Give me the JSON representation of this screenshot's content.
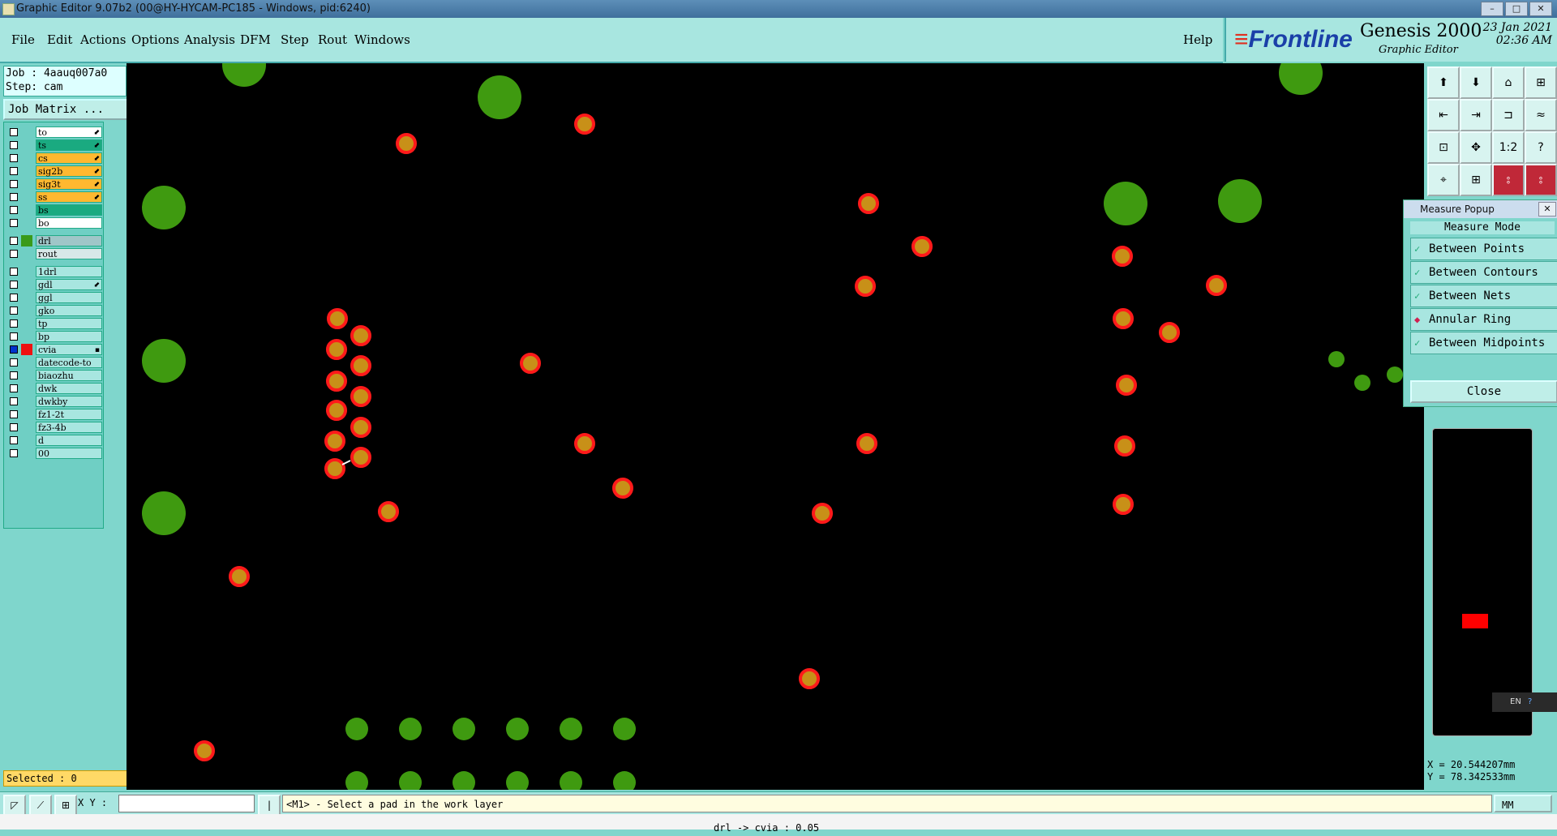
{
  "window": {
    "title": "Graphic Editor 9.07b2 (00@HY-HYCAM-PC185 - Windows, pid:6240)"
  },
  "menu": [
    {
      "label": "File",
      "name": "menu-file"
    },
    {
      "label": "Edit",
      "name": "menu-edit"
    },
    {
      "label": "Actions",
      "name": "menu-actions"
    },
    {
      "label": "Options",
      "name": "menu-options"
    },
    {
      "label": "Analysis",
      "name": "menu-analysis"
    },
    {
      "label": "DFM",
      "name": "menu-dfm"
    },
    {
      "label": "Step",
      "name": "menu-step"
    },
    {
      "label": "Rout",
      "name": "menu-rout"
    },
    {
      "label": "Windows",
      "name": "menu-windows"
    }
  ],
  "help_label": "Help",
  "brand": {
    "logo": "Frontline",
    "product": "Genesis 2000",
    "subtitle": "Graphic Editor",
    "date": "23 Jan 2021",
    "time": "02:36 AM"
  },
  "job": {
    "job_line": "Job : 4aauq007a0",
    "step_line": "Step: cam",
    "matrix_button": "Job Matrix ..."
  },
  "layers": [
    {
      "name": "to",
      "color": "#ffffff",
      "swatch": "",
      "mark": "⬋"
    },
    {
      "name": "ts",
      "color": "#1aaa80",
      "swatch": "",
      "mark": "⬋"
    },
    {
      "name": "cs",
      "color": "#ffb830",
      "swatch": "",
      "mark": "⬋"
    },
    {
      "name": "sig2b",
      "color": "#ffb830",
      "swatch": "",
      "mark": "⬋"
    },
    {
      "name": "sig3t",
      "color": "#ffb830",
      "swatch": "",
      "mark": "⬋"
    },
    {
      "name": "ss",
      "color": "#ffb830",
      "swatch": "",
      "mark": "⬋"
    },
    {
      "name": "bs",
      "color": "#1aaa80",
      "swatch": "",
      "mark": ""
    },
    {
      "name": "bo",
      "color": "#ffffff",
      "swatch": "",
      "mark": ""
    },
    {
      "name": "drl",
      "color": "#9fc6c8",
      "swatch": "#3a9a1a",
      "mark": ""
    },
    {
      "name": "rout",
      "color": "#d8e8e8",
      "swatch": "",
      "mark": ""
    },
    {
      "name": "1drl",
      "color": "#a8e6e0",
      "swatch": "",
      "mark": ""
    },
    {
      "name": "gdl",
      "color": "#a8e6e0",
      "swatch": "",
      "mark": "⬋"
    },
    {
      "name": "ggl",
      "color": "#a8e6e0",
      "swatch": "",
      "mark": ""
    },
    {
      "name": "gko",
      "color": "#a8e6e0",
      "swatch": "",
      "mark": ""
    },
    {
      "name": "tp",
      "color": "#a8e6e0",
      "swatch": "",
      "mark": ""
    },
    {
      "name": "bp",
      "color": "#a8e6e0",
      "swatch": "",
      "mark": ""
    },
    {
      "name": "cvia",
      "color": "#a8e6e0",
      "swatch": "#ee1111",
      "mark": "▪"
    },
    {
      "name": "datecode-to",
      "color": "#a8e6e0",
      "swatch": "",
      "mark": ""
    },
    {
      "name": "biaozhu",
      "color": "#a8e6e0",
      "swatch": "",
      "mark": ""
    },
    {
      "name": "dwk",
      "color": "#a8e6e0",
      "swatch": "",
      "mark": ""
    },
    {
      "name": "dwkby",
      "color": "#a8e6e0",
      "swatch": "",
      "mark": ""
    },
    {
      "name": "fz1-2t",
      "color": "#a8e6e0",
      "swatch": "",
      "mark": ""
    },
    {
      "name": "fz3-4b",
      "color": "#a8e6e0",
      "swatch": "",
      "mark": ""
    },
    {
      "name": "d",
      "color": "#a8e6e0",
      "swatch": "",
      "mark": ""
    },
    {
      "name": "00",
      "color": "#a8e6e0",
      "swatch": "",
      "mark": ""
    }
  ],
  "selected_text": "Selected : 0",
  "toolbar_icons": [
    "open-icon",
    "save-icon",
    "home-icon",
    "layout-icon",
    "prev-icon",
    "next-icon",
    "snap-icon",
    "route-icon",
    "fit-icon",
    "zoom-icon",
    "scale-icon",
    "help-icon",
    "measure-icon",
    "grid-icon",
    "layer-a-icon",
    "layer-b-icon"
  ],
  "toolbar_glyphs": [
    "⬆",
    "⬇",
    "⌂",
    "⊞",
    "⇤",
    "⇥",
    "⊐",
    "≈",
    "⊡",
    "✥",
    "1:2",
    "?",
    "⌖",
    "⊞",
    "⦂",
    "⦂"
  ],
  "measure_popup": {
    "title": "Measure Popup",
    "mode_heading": "Measure Mode",
    "options": [
      {
        "label": "Between Points",
        "selected": false
      },
      {
        "label": "Between Contours",
        "selected": false
      },
      {
        "label": "Between Nets",
        "selected": false
      },
      {
        "label": "Annular Ring",
        "selected": true
      },
      {
        "label": "Between Midpoints",
        "selected": false
      }
    ],
    "close_label": "Close"
  },
  "language_indicator": "EN",
  "coordinates": {
    "x": "X = 20.544207mm",
    "y": "Y = 78.342533mm"
  },
  "status": {
    "xy_label": "X Y :",
    "xy_value": "",
    "message": "<M1> - Select a pad in the work layer",
    "units": "MM"
  },
  "bottom_text": "drl -> cvia : 0.05",
  "colors": {
    "pad_fill": "#c89018",
    "pad_ring": "#ff1a1a",
    "drill": "#3f9a10",
    "background": "#000000"
  }
}
